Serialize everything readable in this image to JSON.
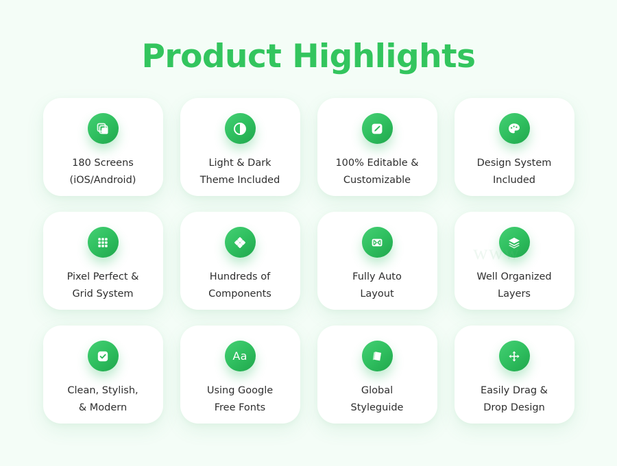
{
  "page": {
    "title": "Product Highlights",
    "background_color": "#f4fdf7",
    "accent_color": "#33c55e",
    "card_color": "#ffffff",
    "text_color": "#2e2e2e",
    "watermark": "www"
  },
  "cards": [
    {
      "icon": "copy-layers-icon",
      "label": "180 Screens\n(iOS/Android)"
    },
    {
      "icon": "contrast-half-circle-icon",
      "label": "Light & Dark\nTheme Included"
    },
    {
      "icon": "pencil-edit-square-icon",
      "label": "100% Editable &\nCustomizable"
    },
    {
      "icon": "paint-palette-icon",
      "label": "Design System\nIncluded"
    },
    {
      "icon": "grid-3x3-icon",
      "label": "Pixel Perfect &\nGrid System"
    },
    {
      "icon": "components-diamond-icon",
      "label": "Hundreds of\nComponents"
    },
    {
      "icon": "auto-layout-icon",
      "label": "Fully Auto\nLayout"
    },
    {
      "icon": "layers-stack-icon",
      "label": "Well Organized\nLayers"
    },
    {
      "icon": "checkbox-check-icon",
      "label": "Clean, Stylish,\n& Modern"
    },
    {
      "icon": "typography-aa-icon",
      "label": "Using Google\nFree Fonts",
      "glyph_text": "Aa"
    },
    {
      "icon": "book-styleguide-icon",
      "label": "Global\nStyleguide"
    },
    {
      "icon": "move-arrows-icon",
      "label": "Easily Drag &\nDrop Design"
    }
  ]
}
